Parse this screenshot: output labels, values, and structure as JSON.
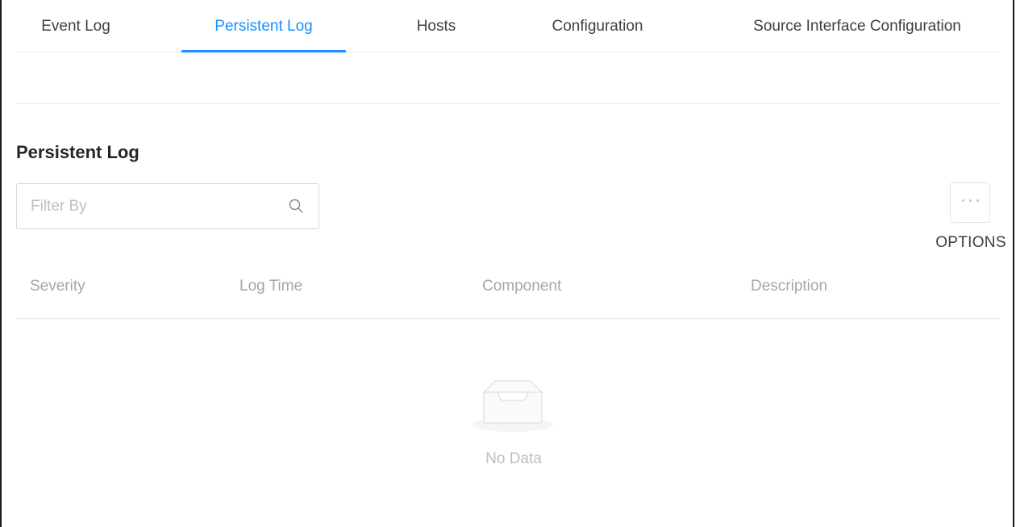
{
  "tabs": [
    {
      "label": "Event Log",
      "active": false
    },
    {
      "label": "Persistent Log",
      "active": true
    },
    {
      "label": "Hosts",
      "active": false
    },
    {
      "label": "Configuration",
      "active": false
    },
    {
      "label": "Source Interface Configuration",
      "active": false
    }
  ],
  "section": {
    "title": "Persistent Log"
  },
  "filter": {
    "placeholder": "Filter By",
    "value": "",
    "icon": "search-icon"
  },
  "options": {
    "label": "OPTIONS",
    "icon": "ellipsis-icon"
  },
  "table": {
    "columns": [
      "Severity",
      "Log Time",
      "Component",
      "Description"
    ],
    "rows": [],
    "empty_text": "No Data",
    "empty_icon": "empty-inbox-icon"
  },
  "colors": {
    "accent": "#1890ff",
    "muted_text": "#a6a6a6",
    "border": "#e8e8e8"
  }
}
